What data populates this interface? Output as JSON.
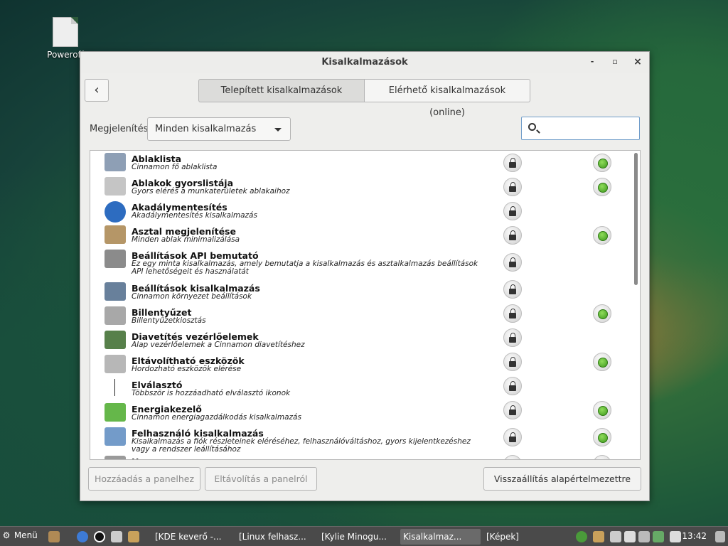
{
  "desktop": {
    "icon_label": "Poweroff"
  },
  "window": {
    "title": "Kisalkalmazások",
    "controls": {
      "minimize": "-",
      "maximize": "▫",
      "close": "×"
    },
    "back": "‹",
    "tabs": [
      "Telepített kisalkalmazások",
      "Elérhető kisalkalmazások (online)"
    ],
    "filter_label": "Megjelenítés",
    "filter_value": "Minden kisalkalmazás",
    "search_value": "",
    "applets": [
      {
        "name": "Ablaklista",
        "desc": "Cinnamon fő ablaklista",
        "enabled": true
      },
      {
        "name": "Ablakok gyorslistája",
        "desc": "Gyors elérés a munkaterületek ablakaihoz",
        "enabled": true
      },
      {
        "name": "Akadálymentesítés",
        "desc": "Akadálymentesítés kisalkalmazás",
        "enabled": false
      },
      {
        "name": "Asztal megjelenítése",
        "desc": "Minden ablak minimalizálása",
        "enabled": true
      },
      {
        "name": "Beállítások API bemutató",
        "desc": "Ez egy minta kisalkalmazás, amely bemutatja a kisalkalmazás és asztalkalmazás beállítások API lehetőségeit és használatát",
        "enabled": false
      },
      {
        "name": "Beállítások kisalkalmazás",
        "desc": "Cinnamon környezet beállítások",
        "enabled": false
      },
      {
        "name": "Billentyűzet",
        "desc": "Billentyűzetkiosztás",
        "enabled": true
      },
      {
        "name": "Diavetítés vezérlőelemek",
        "desc": "Alap vezérlőelemek a Cinnamon diavetítéshez",
        "enabled": false
      },
      {
        "name": "Eltávolítható eszközök",
        "desc": "Hordozható eszközök elérése",
        "enabled": true
      },
      {
        "name": "Elválasztó",
        "desc": "Többször is hozzáadható elválasztó ikonok",
        "enabled": false
      },
      {
        "name": "Energiakezelő",
        "desc": "Cinnamon energiagazdálkodás kisalkalmazás",
        "enabled": true
      },
      {
        "name": "Felhasználó kisalkalmazás",
        "desc": "Kisalkalmazás a fiók részleteinek eléréséhez, felhasználóváltáshoz, gyors kijelentkezéshez vagy a rendszer leállításához",
        "enabled": true
      },
      {
        "name": "Hang",
        "desc": "",
        "enabled": true
      }
    ],
    "buttons": {
      "add": "Hozzáadás a panelhez",
      "remove": "Eltávolítás a panelról",
      "reset": "Visszaállítás alapértelmezettre"
    }
  },
  "taskbar": {
    "menu_label": "Menü",
    "tasks": [
      "[KDE keverő -...",
      "[Linux felhasz...",
      "[Kylie Minogu...",
      "Kisalkalmaz...",
      "[Képek]"
    ],
    "clock": "13:42"
  }
}
